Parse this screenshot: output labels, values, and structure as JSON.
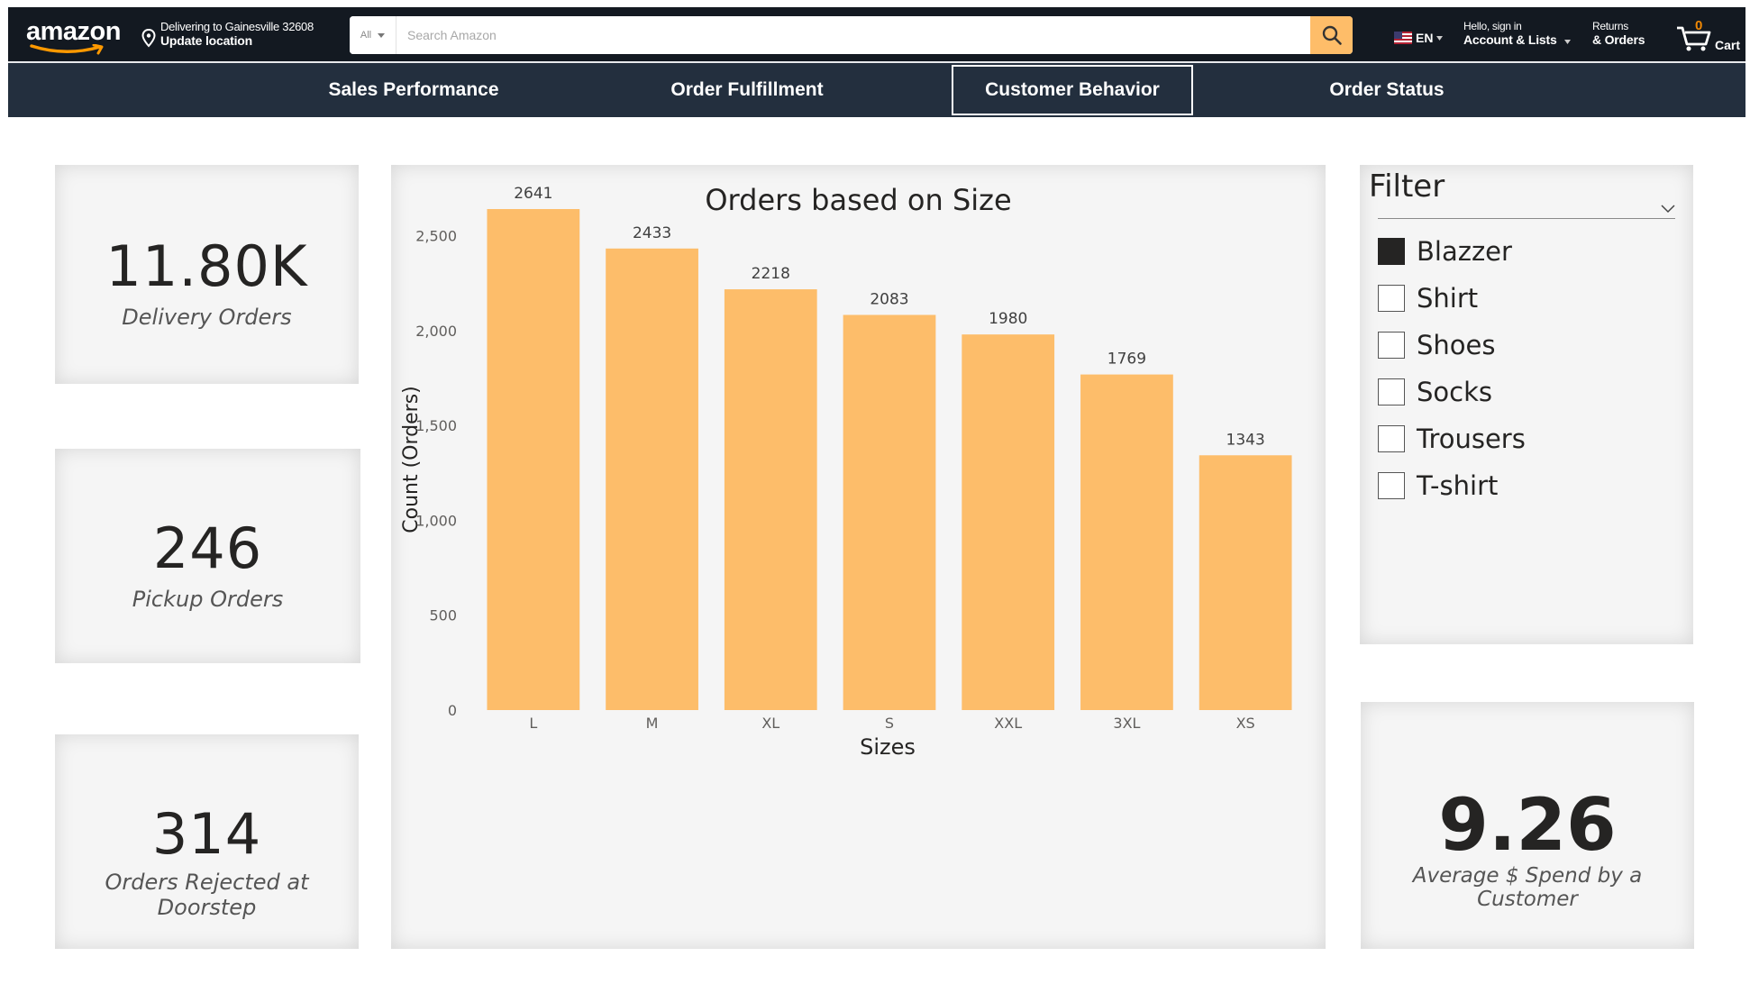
{
  "header": {
    "logo_text": "amazon",
    "delivery_line1": "Delivering to Gainesville 32608",
    "delivery_line2": "Update location",
    "search_category": "All",
    "search_placeholder": "Search Amazon",
    "language": "EN",
    "account_line1": "Hello, sign in",
    "account_line2": "Account & Lists",
    "returns_line1": "Returns",
    "returns_line2": "& Orders",
    "cart_count": "0",
    "cart_label": "Cart"
  },
  "nav": {
    "tabs": [
      {
        "label": "Sales Performance",
        "active": false
      },
      {
        "label": "Order Fulfillment",
        "active": false
      },
      {
        "label": "Customer Behavior",
        "active": true
      },
      {
        "label": "Order Status",
        "active": false
      }
    ]
  },
  "kpis": {
    "delivery": {
      "value": "11.80K",
      "label": "Delivery Orders"
    },
    "pickup": {
      "value": "246",
      "label": "Pickup Orders"
    },
    "rejected": {
      "value": "314",
      "label": "Orders Rejected at Doorstep"
    },
    "avg_spend": {
      "value": "9.26",
      "label": "Average $ Spend by a Customer"
    }
  },
  "filter": {
    "title": "Filter",
    "items": [
      {
        "label": "Blazzer",
        "checked": true
      },
      {
        "label": "Shirt",
        "checked": false
      },
      {
        "label": "Shoes",
        "checked": false
      },
      {
        "label": "Socks",
        "checked": false
      },
      {
        "label": "Trousers",
        "checked": false
      },
      {
        "label": "T-shirt",
        "checked": false
      }
    ]
  },
  "colors": {
    "header_bg": "#131921",
    "nav_bg": "#232f3e",
    "search_button": "#febd69",
    "bar": "#fdbd6a"
  },
  "chart_data": {
    "type": "bar",
    "title": "Orders based on Size",
    "xlabel": "Sizes",
    "ylabel": "Count (Orders)",
    "categories": [
      "L",
      "M",
      "XL",
      "S",
      "XXL",
      "3XL",
      "XS"
    ],
    "values": [
      2641,
      2433,
      2218,
      2083,
      1980,
      1769,
      1343
    ],
    "yticks": [
      0,
      500,
      1000,
      1500,
      2000,
      2500
    ],
    "ytick_labels": [
      "0",
      "500",
      "1,000",
      "1,500",
      "2,000",
      "2,500"
    ],
    "ylim": [
      0,
      2641
    ],
    "grid": false,
    "legend": "none"
  }
}
